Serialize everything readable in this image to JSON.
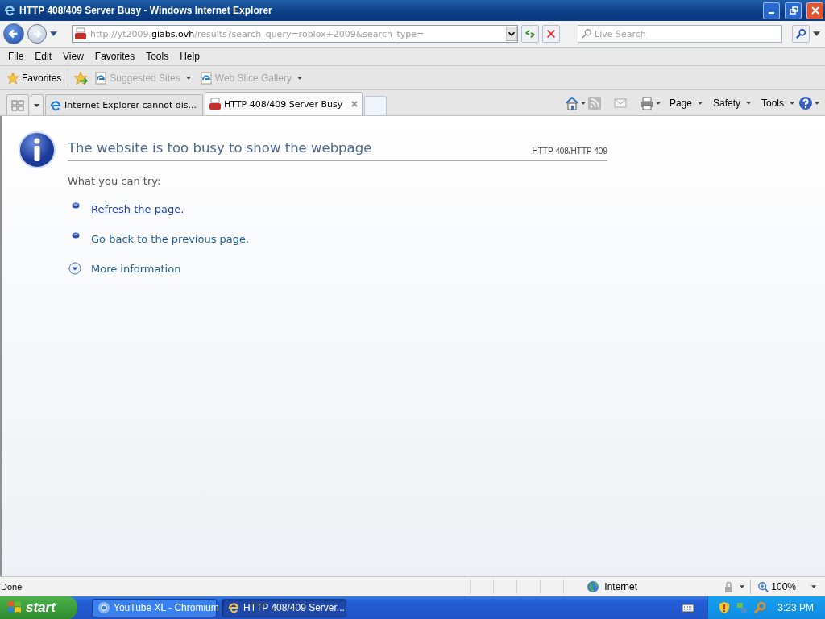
{
  "window": {
    "title": "HTTP 408/409 Server Busy - Windows Internet Explorer"
  },
  "address_bar": {
    "url_prefix": "http://yt2009.",
    "url_domain": "giabs.ovh",
    "url_path": "/results?search_query=roblox+2009&search_type="
  },
  "search": {
    "placeholder": "Live Search"
  },
  "menu": [
    "File",
    "Edit",
    "View",
    "Favorites",
    "Tools",
    "Help"
  ],
  "favorites_bar": {
    "favorites": "Favorites",
    "links": [
      {
        "label": "Suggested Sites",
        "disabled": true
      },
      {
        "label": "Web Slice Gallery",
        "disabled": true
      }
    ]
  },
  "tabs": [
    {
      "label": "Internet Explorer cannot dis...",
      "kind": "ie",
      "selected": false
    },
    {
      "label": "HTTP 408/409 Server Busy",
      "kind": "youtube",
      "selected": true
    }
  ],
  "command_bar": [
    {
      "label": "Page"
    },
    {
      "label": "Safety"
    },
    {
      "label": "Tools"
    }
  ],
  "page": {
    "heading": "The website is too busy to show the webpage",
    "code": "HTTP 408/HTTP 409",
    "intro": "What you can try:",
    "items": [
      {
        "kind": "bullet",
        "label": "Refresh the page.",
        "hovered": true
      },
      {
        "kind": "bullet",
        "label": "Go back to the previous page.",
        "hovered": false
      },
      {
        "kind": "expander",
        "label": "More information",
        "hovered": false
      }
    ]
  },
  "status_bar": {
    "text": "Done",
    "zone": "Internet",
    "zoom": "100%"
  },
  "taskbar": {
    "start": "start",
    "items": [
      {
        "label": "YouTube XL - Chromium",
        "kind": "chromium",
        "selected": false
      },
      {
        "label": "HTTP 408/409 Server...",
        "kind": "ie",
        "selected": true
      }
    ],
    "clock": "3:23 PM"
  }
}
